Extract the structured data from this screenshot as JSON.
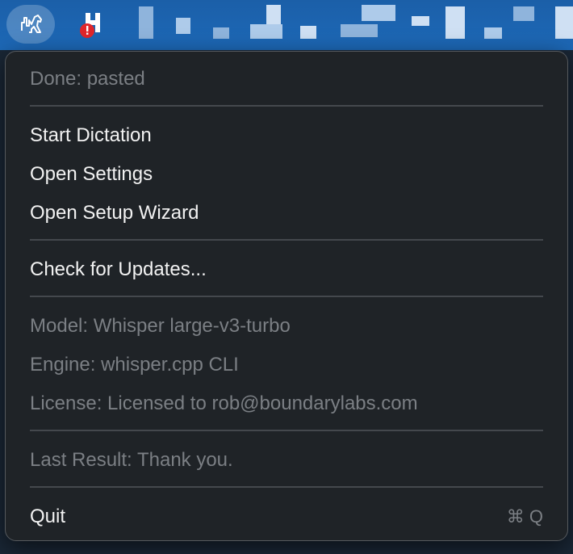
{
  "menubar": {
    "app_icon": "horse-waveform-icon",
    "second_icon": "h-app-icon",
    "alert_badge": "!"
  },
  "menu": {
    "status": "Done: pasted",
    "start_dictation": "Start Dictation",
    "open_settings": "Open Settings",
    "open_setup_wizard": "Open Setup Wizard",
    "check_for_updates": "Check for Updates...",
    "model": "Model: Whisper large-v3-turbo",
    "engine": "Engine: whisper.cpp CLI",
    "license": "License: Licensed to rob@boundarylabs.com",
    "last_result": "Last Result: Thank you.",
    "quit": "Quit",
    "quit_shortcut": "⌘ Q"
  },
  "colors": {
    "menubar_bg": "#1d66b4",
    "menu_bg": "#1f2327",
    "enabled_text": "#f2f2f2",
    "disabled_text": "#7b7f84",
    "alert_red": "#e0262b"
  }
}
